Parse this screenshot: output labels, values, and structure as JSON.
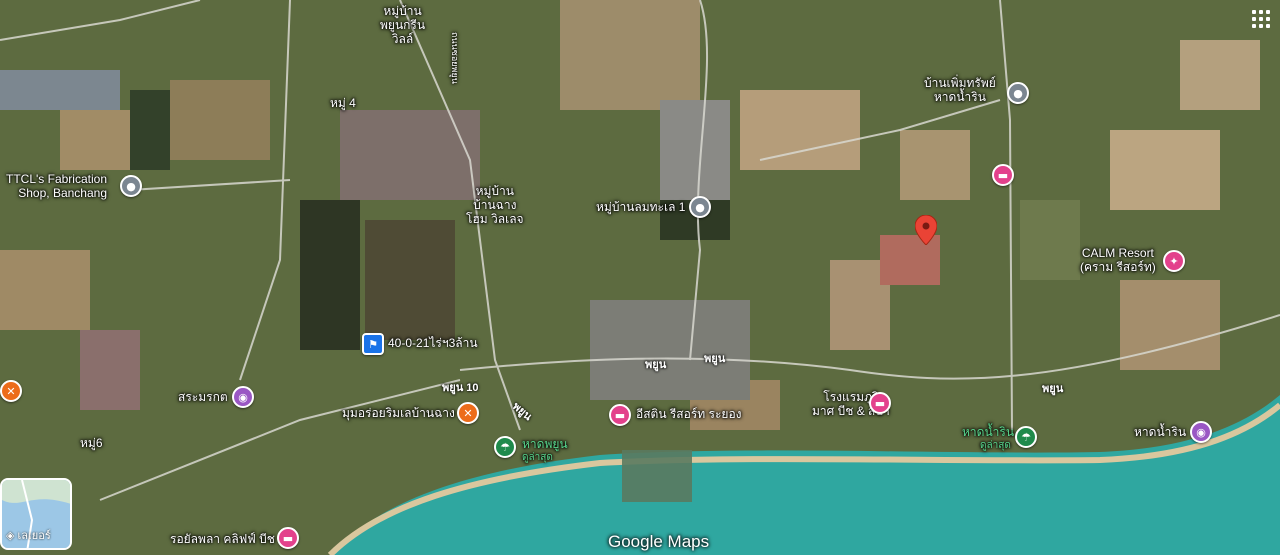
{
  "labels": {
    "village_phukrin": "หมู่บ้าน\nพยูนกรีน\nวิลล์",
    "moo4": "หมู่ 4",
    "road_vertical": "ถนนซอยพยูน",
    "ttcl": "TTCL's Fabrication\nShop, Banchang",
    "village_banchang": "หมู่บ้าน\nบ้านฉาง\nโฮม วิลเลจ",
    "village_lomtalay": "หมู่บ้านลมทะเล 1",
    "banpoemsap": "บ้านเพิ่มทรัพย์\nหาดน้ำริน",
    "calm": "CALM Resort\n(คราม รีสอร์ท)",
    "plot": "40-0-21ไร่ฯ3ล้าน",
    "sasamorakot": "สระมรกต",
    "restaurant": "มุมอร่อยริมเลบ้านฉาง",
    "moo6": "หมู่6",
    "eastin": "อีสติน รีสอร์ท ระยอง",
    "hotel_phuri": "โรงแรมภูริ\nมาศ บีช & สปา",
    "hat_phayun": "หาดพยูน",
    "hat_phayun_sub": "ดูล่าสุด",
    "hat_namrin_green": "หาดน้ำริน",
    "hat_namrin_green_sub": "ดูล่าสุด",
    "hat_namrin": "หาดน้ำริน",
    "royal": "รอยัลพลา คลิฟฟ์ บีช"
  },
  "roads": {
    "phayun1": "พยูน",
    "phayun2": "พยูน",
    "phayun3": "พยูน",
    "phayun10": "พยูน 10",
    "phayun_diag": "พยูน"
  },
  "controls": {
    "layers_label": "เลเยอร์",
    "logo": "Google Maps"
  },
  "icons": {
    "grey": "place-icon",
    "pink_hotel": "hotel-icon",
    "purple_camera": "camera-icon",
    "orange_food": "restaurant-icon",
    "green_beach": "beach-icon",
    "blue_flag": "flag-icon",
    "red_pin": "location-pin-icon"
  },
  "colors": {
    "sea": "#2fa7a0",
    "pin_pink": "#e3418c",
    "pin_red": "#ea4335"
  }
}
